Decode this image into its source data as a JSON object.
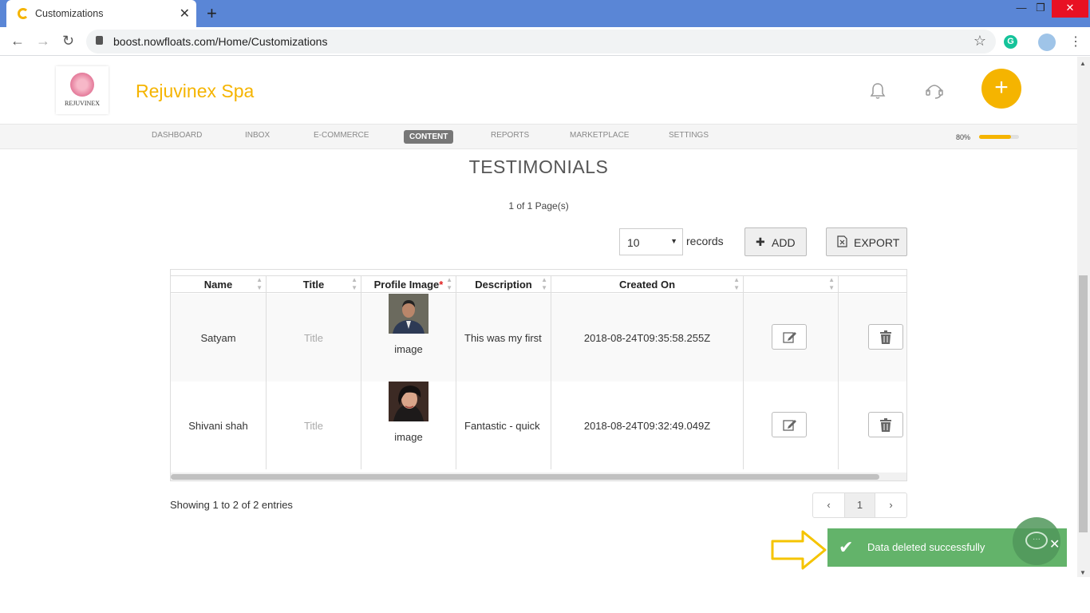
{
  "browser": {
    "tab_title": "Customizations",
    "url": "boost.nowfloats.com/Home/Customizations"
  },
  "header": {
    "logo_text": "REJUVINEX",
    "brand": "Rejuvinex Spa"
  },
  "menu": {
    "items": [
      "DASHBOARD",
      "INBOX",
      "E-COMMERCE",
      "CONTENT",
      "REPORTS",
      "MARKETPLACE",
      "SETTINGS"
    ],
    "active": "CONTENT",
    "progress_label": "80%",
    "progress_value": 0.8
  },
  "content": {
    "title": "TESTIMONIALS",
    "page_count": "1 of 1 Page(s)",
    "records_value": "10",
    "records_label": "records",
    "add_label": "ADD",
    "export_label": "EXPORT"
  },
  "table": {
    "columns": [
      "Name",
      "Title",
      "Profile Image",
      "Description",
      "Created On",
      "",
      ""
    ],
    "required_mark": "*",
    "rows": [
      {
        "name": "Satyam",
        "title": "Title",
        "image_label": "image",
        "description": "This was my first",
        "created_on": "2018-08-24T09:35:58.255Z"
      },
      {
        "name": "Shivani shah",
        "title": "Title",
        "image_label": "image",
        "description": "Fantastic - quick",
        "created_on": "2018-08-24T09:32:49.049Z"
      }
    ]
  },
  "footer": {
    "showing": "Showing 1 to 2 of 2 entries",
    "current_page": "1"
  },
  "toast": {
    "message": "Data deleted successfully"
  }
}
